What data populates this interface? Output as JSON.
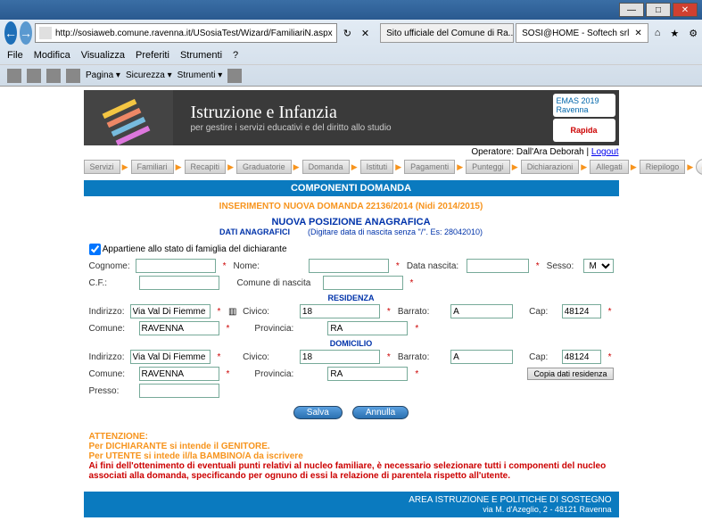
{
  "browser": {
    "title_prefix": "",
    "url": "http://sosiaweb.comune.ravenna.it/USosiaTest/Wizard/FamiliariN.aspx",
    "tabs": [
      {
        "label": "Sito ufficiale del Comune di Ra..."
      },
      {
        "label": "SOSI@HOME - Softech srl"
      }
    ],
    "menu": [
      "File",
      "Modifica",
      "Visualizza",
      "Preferiti",
      "Strumenti",
      "?"
    ],
    "toolbar_dropdowns": [
      "Pagina ▾",
      "Sicurezza ▾",
      "Strumenti ▾"
    ]
  },
  "banner": {
    "title": "Istruzione e Infanzia",
    "subtitle": "per gestire i servizi educativi e del diritto allo studio",
    "logos": [
      "EMAS  2019 Ravenna",
      "Rapida"
    ]
  },
  "operator": {
    "prefix": "Operatore: ",
    "name": "Dall'Ara Deborah",
    "logout": "Logout"
  },
  "breadcrumb": [
    "Servizi",
    "Familiari",
    "Recapiti",
    "Graduatorie",
    "Domanda",
    "Istituti",
    "Pagamenti",
    "Punteggi",
    "Dichiarazioni",
    "Allegati",
    "Riepilogo"
  ],
  "section_title": "COMPONENTI DOMANDA",
  "ins_title": "INSERIMENTO NUOVA DOMANDA 22136/2014 (Nidi 2014/2015)",
  "pos_title": "NUOVA POSIZIONE ANAGRAFICA",
  "dati_label": "DATI ANAGRAFICI",
  "dati_hint": "(Digitare data di nascita senza \"/\". Es: 28042010)",
  "checkbox_label": "Appartiene allo stato di famiglia del dichiarante",
  "labels": {
    "cognome": "Cognome:",
    "cf": "C.F.:",
    "nome": "Nome:",
    "comune_nascita": "Comune di nascita",
    "data_nascita": "Data nascita:",
    "sesso": "Sesso:",
    "indirizzo": "Indirizzo:",
    "comune": "Comune:",
    "civico": "Civico:",
    "provincia": "Provincia:",
    "barrato": "Barrato:",
    "cap": "Cap:",
    "presso": "Presso:"
  },
  "sections": {
    "residenza": "RESIDENZA",
    "domicilio": "DOMICILIO"
  },
  "values": {
    "sesso": "M",
    "res_indirizzo": "Via Val Di Fiemme",
    "res_comune": "RAVENNA",
    "res_civico": "18",
    "res_provincia": "RA",
    "res_barrato": "A",
    "res_cap": "48124",
    "dom_indirizzo": "Via Val Di Fiemme",
    "dom_comune": "RAVENNA",
    "dom_civico": "18",
    "dom_provincia": "RA",
    "dom_barrato": "A",
    "dom_cap": "48124"
  },
  "buttons": {
    "salva": "Salva",
    "annulla": "Annulla",
    "copia": "Copia dati residenza"
  },
  "attn": {
    "h": "ATTENZIONE:",
    "l1": "Per DICHIARANTE si intende il GENITORE.",
    "l2": "Per UTENTE si intede il/la BAMBINO/A da iscrivere",
    "l3": "Ai fini dell'ottenimento di eventuali punti relativi al nucleo familiare, è necessario selezionare tutti i componenti del nucleo associati alla domanda, specificando per ognuno di essi la relazione di parentela rispetto all'utente."
  },
  "footer": {
    "l1": "AREA ISTRUZIONE E POLITICHE DI SOSTEGNO",
    "l2": "via M. d'Azeglio, 2 - 48121 Ravenna"
  }
}
